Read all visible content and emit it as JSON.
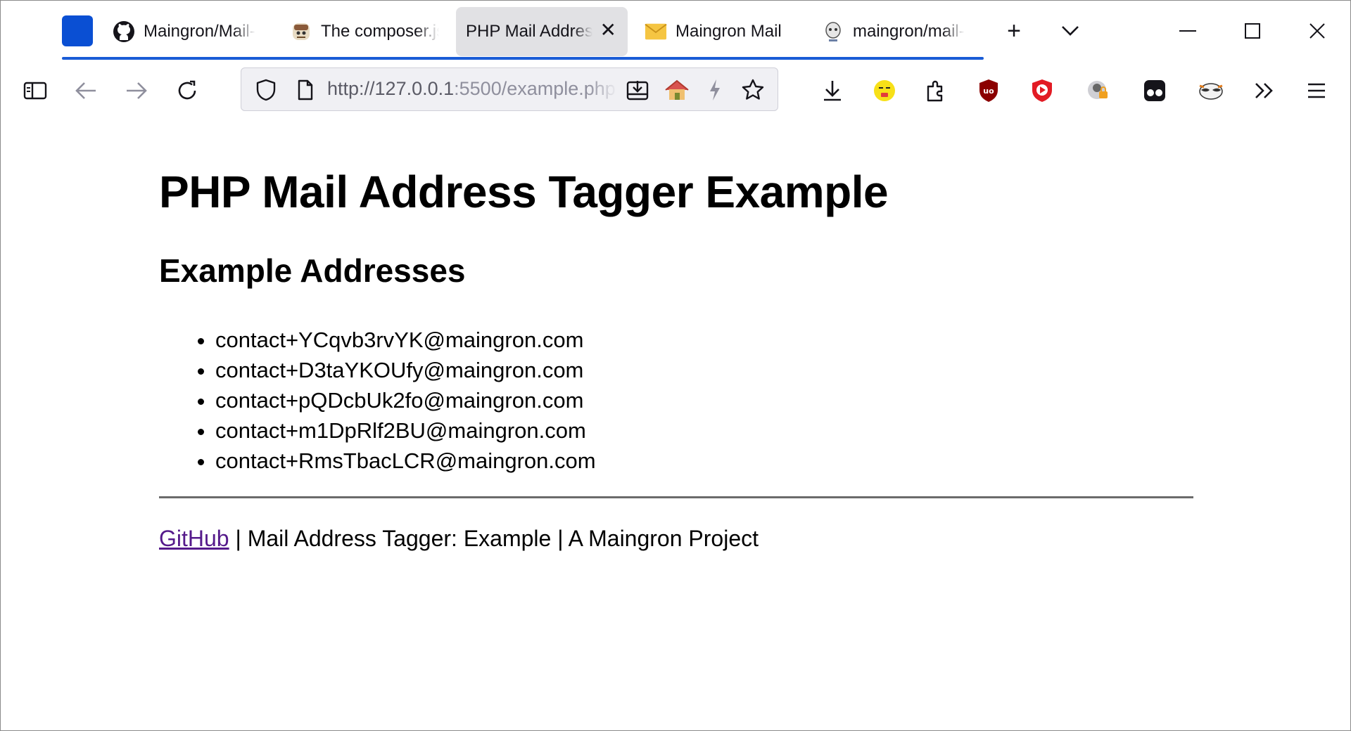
{
  "browser": {
    "tabs": [
      {
        "title": "Maingron/Mail-",
        "favicon": "github-icon"
      },
      {
        "title": "The composer.js",
        "favicon": "composer-icon"
      },
      {
        "title": "PHP Mail Address",
        "favicon": "none",
        "active": true,
        "close": "✕"
      },
      {
        "title": "Maingron Mail",
        "favicon": "envelope-icon"
      },
      {
        "title": "maingron/mail-",
        "favicon": "packagist-icon"
      }
    ],
    "new_tab": "+",
    "list_tabs": "⌄",
    "window_controls": {
      "minimize": "—",
      "maximize": "☐",
      "close": "✕"
    },
    "url": {
      "host": "http://127.0.0.1",
      "rest": ":5500/example.php"
    },
    "accent_color": "#1a5cd6"
  },
  "page": {
    "title": "PHP Mail Address Tagger Example",
    "section_title": "Example Addresses",
    "addresses": [
      "contact+YCqvb3rvYK@maingron.com",
      "contact+D3taYKOUfy@maingron.com",
      "contact+pQDcbUk2fo@maingron.com",
      "contact+m1DpRlf2BU@maingron.com",
      "contact+RmsTbacLCR@maingron.com"
    ],
    "footer": {
      "link_text": "GitHub",
      "text": " | Mail Address Tagger: Example | A Maingron Project"
    }
  }
}
